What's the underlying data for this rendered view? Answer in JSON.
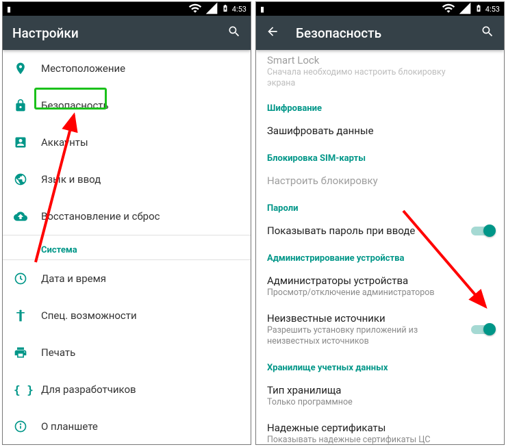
{
  "status": {
    "time": "4:53"
  },
  "left": {
    "title": "Настройки",
    "items": [
      {
        "icon": "location",
        "label": "Местоположение"
      },
      {
        "icon": "lock",
        "label": "Безопасность"
      },
      {
        "icon": "account",
        "label": "Аккаунты"
      },
      {
        "icon": "globe",
        "label": "Язык и ввод"
      },
      {
        "icon": "backup",
        "label": "Восстановление и сброс"
      }
    ],
    "system_header": "Система",
    "system_items": [
      {
        "icon": "clock",
        "label": "Дата и время"
      },
      {
        "icon": "a11y",
        "label": "Спец. возможности"
      },
      {
        "icon": "print",
        "label": "Печать"
      },
      {
        "icon": "braces",
        "label": "Для разработчиков"
      },
      {
        "icon": "info",
        "label": "О планшете"
      }
    ]
  },
  "right": {
    "title": "Безопасность",
    "smart_lock": {
      "label": "Smart Lock",
      "sub": "Сначала необходимо настроить блокировку экрана"
    },
    "enc_header": "Шифрование",
    "encrypt": "Зашифровать данные",
    "sim_header": "Блокировка SIM-карты",
    "sim_setup": "Настроить блокировку",
    "pwd_header": "Пароли",
    "show_pwd": "Показывать пароль при вводе",
    "admin_header": "Администрирование устройства",
    "dev_admin": {
      "label": "Администраторы устройства",
      "sub": "Просмотр/отключение администраторов"
    },
    "unknown": {
      "label": "Неизвестные источники",
      "sub": "Разрешить установку приложений из неизвестных источников"
    },
    "cred_header": "Хранилище учетных данных",
    "storage_type": {
      "label": "Тип хранилища",
      "sub": "Только программное"
    },
    "trusted": {
      "label": "Надежные сертификаты",
      "sub": "Показывать надежные сертификаты ЦС"
    }
  }
}
